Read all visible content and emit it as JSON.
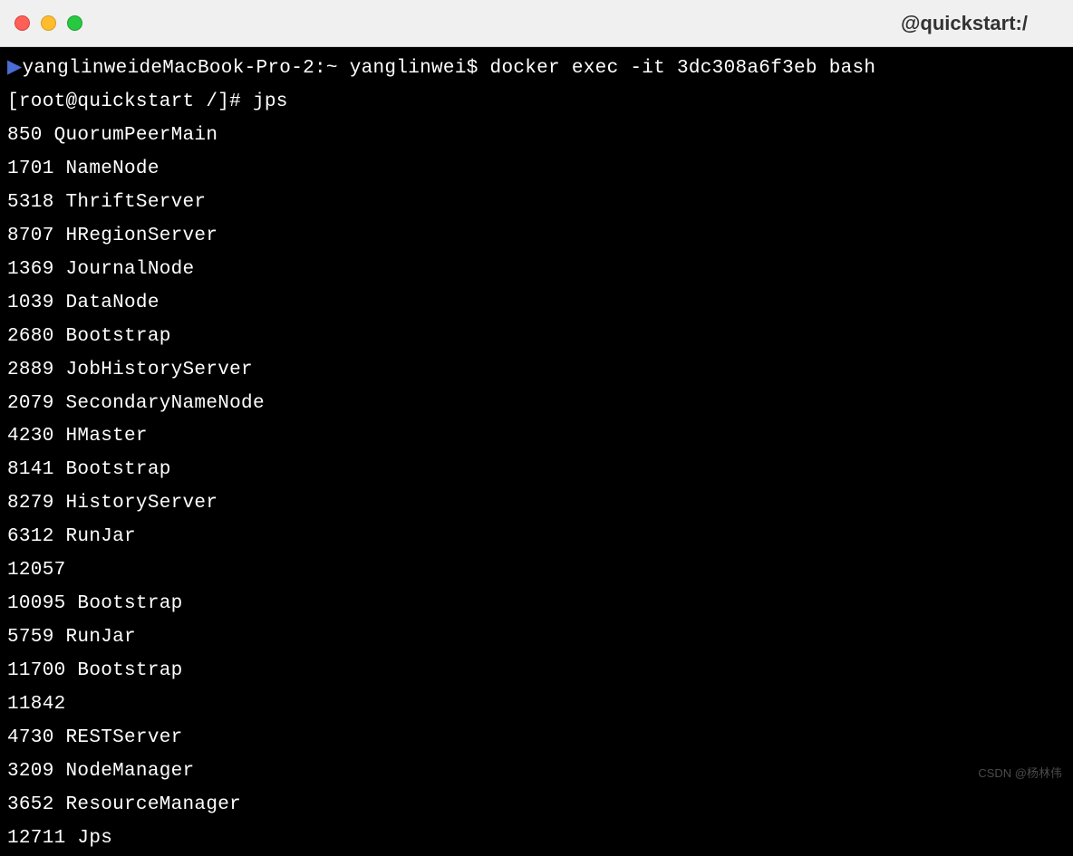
{
  "titlebar": {
    "title": "@quickstart:/"
  },
  "terminal": {
    "line1_prompt_arrow": "▶",
    "line1_prompt": "yanglinweideMacBook-Pro-2:~ yanglinwei$ ",
    "line1_cmd": "docker exec -it 3dc308a6f3eb bash",
    "line2_prompt": "[root@quickstart /]# ",
    "line2_cmd": "jps",
    "output": [
      "850 QuorumPeerMain",
      "1701 NameNode",
      "5318 ThriftServer",
      "8707 HRegionServer",
      "1369 JournalNode",
      "1039 DataNode",
      "2680 Bootstrap",
      "2889 JobHistoryServer",
      "2079 SecondaryNameNode",
      "4230 HMaster",
      "8141 Bootstrap",
      "8279 HistoryServer",
      "6312 RunJar",
      "12057",
      "10095 Bootstrap",
      "5759 RunJar",
      "11700 Bootstrap",
      "11842",
      "4730 RESTServer",
      "3209 NodeManager",
      "3652 ResourceManager",
      "12711 Jps"
    ]
  },
  "watermark": "CSDN @杨林伟"
}
